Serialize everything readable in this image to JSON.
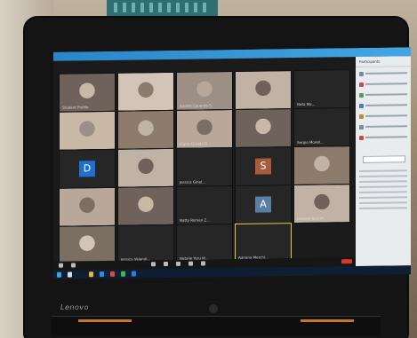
{
  "laptop": {
    "brand": "Lenovo"
  },
  "meeting": {
    "panel_title": "Participants",
    "tiles": [
      {
        "name": "Student Profile",
        "letter": "",
        "kind": "cam"
      },
      {
        "name": "",
        "letter": "",
        "kind": "cam"
      },
      {
        "name": "Andrés Eduardo S.",
        "letter": "",
        "kind": "cam"
      },
      {
        "name": "",
        "letter": "",
        "kind": "cam"
      },
      {
        "name": "Nata Ma...",
        "letter": "",
        "kind": "dark"
      },
      {
        "name": "",
        "letter": "",
        "kind": "cam"
      },
      {
        "name": "",
        "letter": "",
        "kind": "cam"
      },
      {
        "name": "Ingrid Grisela D...",
        "letter": "",
        "kind": "cam"
      },
      {
        "name": "",
        "letter": "",
        "kind": "cam"
      },
      {
        "name": "Sergio Morell...",
        "letter": "",
        "kind": "dark"
      },
      {
        "name": "",
        "letter": "D",
        "kind": "letter",
        "color": "#1f6fd1"
      },
      {
        "name": "",
        "letter": "",
        "kind": "cam"
      },
      {
        "name": "Jessica Ginel...",
        "letter": "",
        "kind": "dark"
      },
      {
        "name": "",
        "letter": "S",
        "kind": "letter",
        "color": "#a65b3c"
      },
      {
        "name": "",
        "letter": "",
        "kind": "cam"
      },
      {
        "name": "",
        "letter": "",
        "kind": "cam"
      },
      {
        "name": "",
        "letter": "",
        "kind": "cam"
      },
      {
        "name": "Natty Roman Z...",
        "letter": "",
        "kind": "dark"
      },
      {
        "name": "",
        "letter": "A",
        "kind": "letter",
        "color": "#5b7ea3"
      },
      {
        "name": "Daniela Ruiz M...",
        "letter": "",
        "kind": "cam"
      },
      {
        "name": "",
        "letter": "",
        "kind": "cam"
      },
      {
        "name": "Jessica Velandi...",
        "letter": "",
        "kind": "dark"
      },
      {
        "name": "Natalie Yaru M...",
        "letter": "",
        "kind": "dark"
      },
      {
        "name": "Adriana Merchi...",
        "letter": "",
        "kind": "active"
      }
    ]
  },
  "colors": {
    "zoom_blue": "#2a86c7",
    "taskbar": "#0e1f33",
    "end_button": "#d23a2a",
    "highlight": "#e1d23b"
  }
}
